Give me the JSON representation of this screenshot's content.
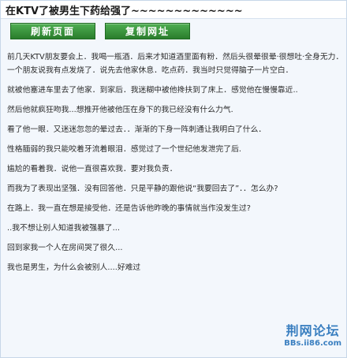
{
  "window": {
    "title": "在KTV了被男生下药给强了~~~~~~~~~~~~~"
  },
  "toolbar": {
    "refresh_label": "刷新页面",
    "copy_label": "复制网址"
  },
  "post": {
    "paragraphs": [
      "前几天KTV朋友要会上．我喝一瓶酒．后来才知道酒里面有粉．然后头很晕很晕·很想吐·全身无力．",
      "一个朋友说我有点发烧了．说先去他家休息．吃点药．我当时只觉得脑子一片空白．",
      "就被他塞进车里去了他家．到家后．我迷糊中被他搀扶到了床上．感觉他在慢慢靠近..",
      "然后他就疯狂吻我...想推开他被他压在身下的我已经没有什么力气.",
      "看了他一眼．又迷迷忽忽的晕过去．．渐渐的下身一阵刺通让我明白了什么．",
      "性格腼弱的我只能咬着牙流着眼泪．感觉过了一个世纪他发泄完了后.",
      "尴尬的看着我．说他一直很喜欢我．要对我负责．",
      "而我为了表现出坚强．没有回答他．只是平静的跟他说“我要回去了”．．怎么办?",
      "在路上．我一直在想是接受他．还是告诉他昨晚的事情就当作没发生过?",
      "..我不想让别人知道我被强暴了...",
      "回到家我一个人在房间哭了很久...",
      "我也是男生，为什么会被别人....好难过"
    ]
  },
  "watermark": {
    "name": "荆网论坛",
    "url": "BBs.ii86.com"
  }
}
